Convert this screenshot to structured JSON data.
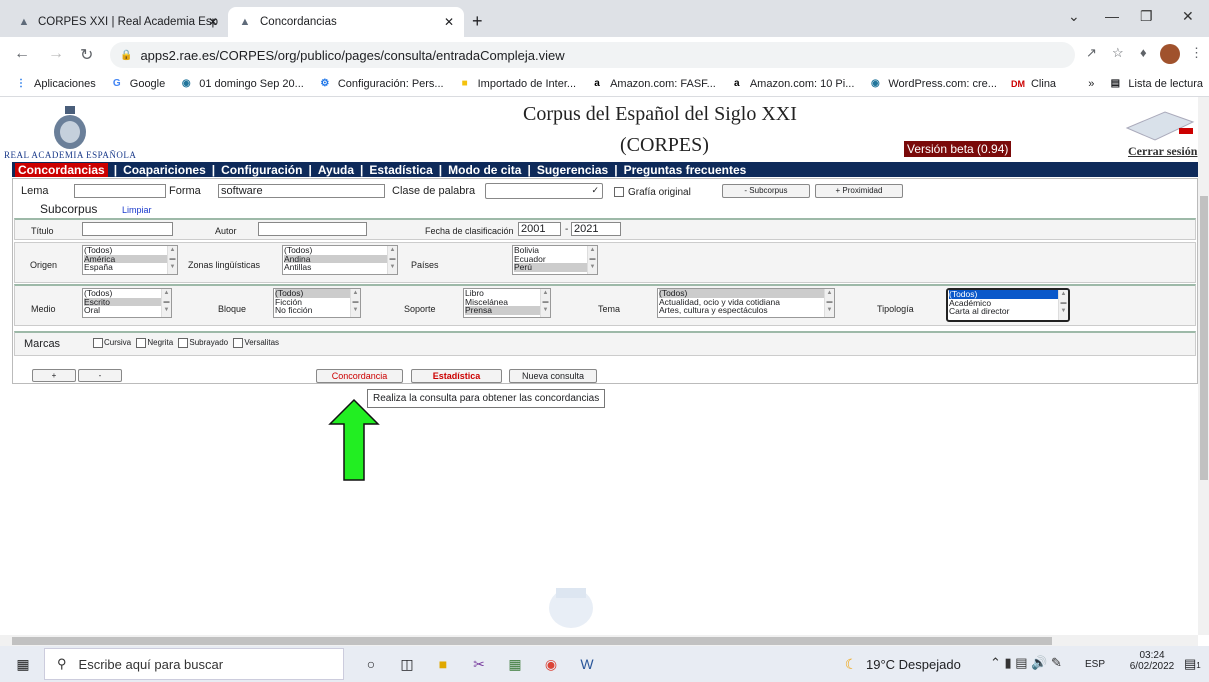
{
  "browser": {
    "tabs": [
      {
        "label": "CORPES XXI | Real Academia Esp",
        "icon": "rae-favicon"
      },
      {
        "label": "Concordancias",
        "icon": "rae-favicon"
      }
    ],
    "url": "apps2.rae.es/CORPES/org/publico/pages/consulta/entradaCompleja.view",
    "bookmarks": [
      {
        "label": "Aplicaciones",
        "icon": "apps-grid-icon"
      },
      {
        "label": "Google",
        "icon": "google-icon"
      },
      {
        "label": "01 domingo Sep 20...",
        "icon": "wordpress-icon"
      },
      {
        "label": "Configuración: Pers...",
        "icon": "gear-icon"
      },
      {
        "label": "Importado de Inter...",
        "icon": "folder-icon"
      },
      {
        "label": "Amazon.com: FASF...",
        "icon": "amazon-icon"
      },
      {
        "label": "Amazon.com: 10 Pi...",
        "icon": "amazon-icon"
      },
      {
        "label": "WordPress.com: cre...",
        "icon": "wordpress-icon"
      },
      {
        "label": "Clina",
        "icon": "dm-icon"
      }
    ],
    "reading_list": "Lista de lectura",
    "more": "»"
  },
  "header": {
    "title_line1": "Corpus del Español del Siglo XXI",
    "title_line2": "(CORPES)",
    "rae": "REAL ACADEMIA ESPAÑOLA",
    "version": "Versión beta (0.94)",
    "logout": "Cerrar sesión"
  },
  "menu": [
    "Concordancias",
    "Coapariciones",
    "Configuración",
    "Ayuda",
    "Estadística",
    "Modo de cita",
    "Sugerencias",
    "Preguntas frecuentes"
  ],
  "search": {
    "lema_label": "Lema",
    "lema_value": "",
    "forma_label": "Forma",
    "forma_value": "software",
    "clase_label": "Clase de palabra",
    "clase_value": "",
    "grafia_label": "Grafía original",
    "subcorpus_btn": "- Subcorpus",
    "proximidad_btn": "+ Proximidad"
  },
  "subcorpus": {
    "title": "Subcorpus",
    "limpiar": "Limpiar",
    "titulo_label": "Título",
    "autor_label": "Autor",
    "fecha_label": "Fecha de clasificación",
    "fecha_from": "2001",
    "fecha_to": "2021",
    "fecha_sep": "-",
    "origen_label": "Origen",
    "origen_options": [
      "(Todos)",
      "América",
      "España"
    ],
    "zonas_label": "Zonas lingüísticas",
    "zonas_options": [
      "(Todos)",
      "Andina",
      "Antillas"
    ],
    "paises_label": "Países",
    "paises_options": [
      "Bolivia",
      "Ecuador",
      "Perú"
    ],
    "medio_label": "Medio",
    "medio_options": [
      "(Todos)",
      "Escrito",
      "Oral"
    ],
    "bloque_label": "Bloque",
    "bloque_options": [
      "(Todos)",
      "Ficción",
      "No ficción"
    ],
    "soporte_label": "Soporte",
    "soporte_options": [
      "Libro",
      "Miscelánea",
      "Prensa"
    ],
    "tema_label": "Tema",
    "tema_options": [
      "(Todos)",
      "Actualidad, ocio y vida cotidiana",
      "Artes, cultura y espectáculos"
    ],
    "tipologia_label": "Tipología",
    "tipologia_options": [
      "(Todos)",
      "Académico",
      "Carta al director"
    ],
    "marcas_label": "Marcas",
    "marcas": [
      "Cursiva",
      "Negrita",
      "Subrayado",
      "Versalitas"
    ]
  },
  "actions": {
    "plus": "+",
    "minus": "-",
    "concordancia": "Concordancia",
    "estadistica": "Estadística",
    "nueva": "Nueva consulta",
    "tooltip": "Realiza la consulta para obtener las concordancias"
  },
  "taskbar": {
    "search_placeholder": "Escribe aquí para buscar",
    "weather": "19°C  Despejado",
    "lang": "ESP",
    "time": "03:24",
    "date": "6/02/2022",
    "notif_count": "1"
  },
  "colors": {
    "menu_bg": "#0e2a5a",
    "active_red": "#cc0000",
    "beta_bg": "#7a0a0a",
    "arrow_green": "#22ee22"
  }
}
